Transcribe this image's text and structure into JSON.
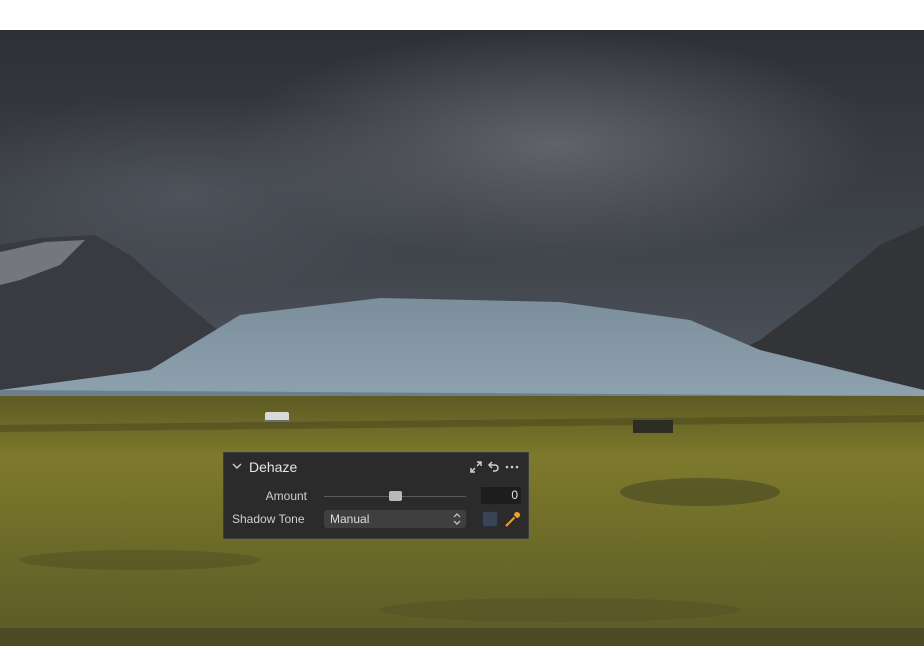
{
  "panel": {
    "title": "Dehaze",
    "amount_label": "Amount",
    "amount_value": "0",
    "amount_slider_fraction": 0.5,
    "shadow_tone_label": "Shadow Tone",
    "shadow_tone_selected": "Manual",
    "shadow_tone_color": "#3a4456",
    "icons": {
      "collapse": "chevron-down-icon",
      "expand": "expand-icon",
      "reset": "reset-icon",
      "more": "more-icon",
      "picker": "color-picker-icon"
    }
  },
  "colors": {
    "panel_bg": "#2b2b2b",
    "picker_accent": "#f0a030"
  }
}
